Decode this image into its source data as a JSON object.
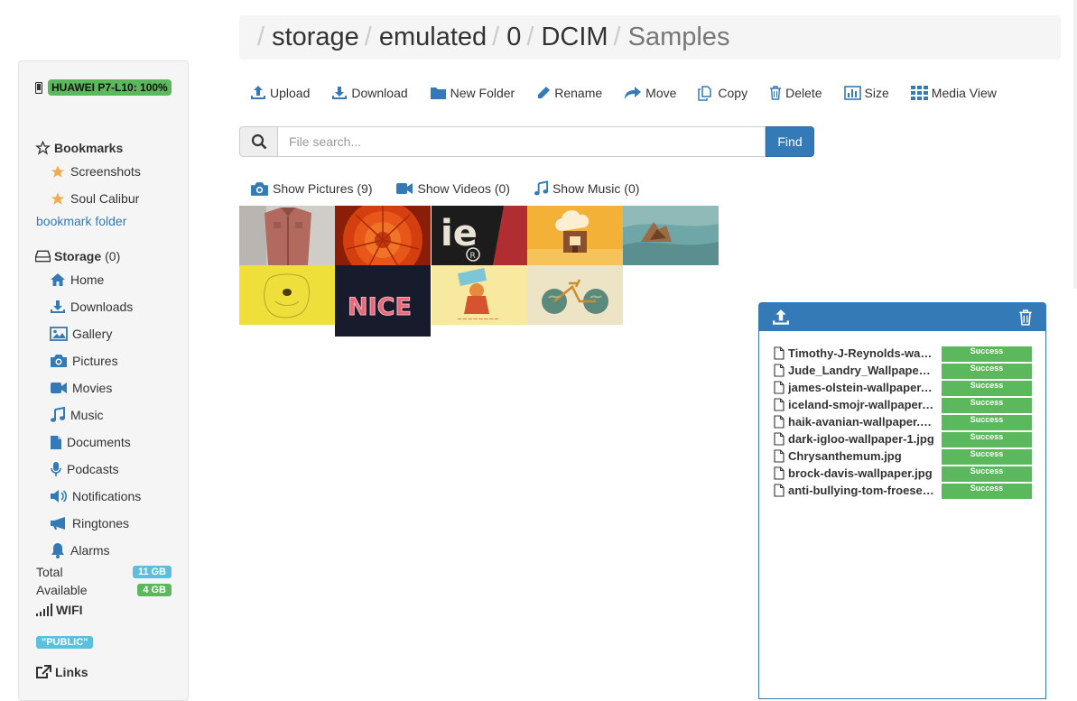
{
  "sidebar": {
    "device": {
      "name": "HUAWEI P7-L10",
      "battery": "100%"
    },
    "bookmarks_heading": "Bookmarks",
    "bookmarks": [
      {
        "label": "Screenshots"
      },
      {
        "label": "Soul Calibur"
      }
    ],
    "bookmark_folder": "bookmark folder",
    "storage_heading": "Storage",
    "storage_count": "(0)",
    "storage_items": [
      {
        "label": "Home",
        "icon": "home-icon"
      },
      {
        "label": "Downloads",
        "icon": "download-icon"
      },
      {
        "label": "Gallery",
        "icon": "image-icon"
      },
      {
        "label": "Pictures",
        "icon": "camera-icon"
      },
      {
        "label": "Movies",
        "icon": "video-icon"
      },
      {
        "label": "Music",
        "icon": "music-icon"
      },
      {
        "label": "Documents",
        "icon": "file-icon"
      },
      {
        "label": "Podcasts",
        "icon": "microphone-icon"
      },
      {
        "label": "Notifications",
        "icon": "volume-icon"
      },
      {
        "label": "Ringtones",
        "icon": "bullhorn-icon"
      },
      {
        "label": "Alarms",
        "icon": "bell-icon"
      }
    ],
    "total_label": "Total",
    "total_value": "11 GB",
    "available_label": "Available",
    "available_value": "4 GB",
    "network": "WIFI",
    "public_badge": "\"PUBLIC\"",
    "links_heading": "Links"
  },
  "breadcrumb": [
    "storage",
    "emulated",
    "0",
    "DCIM",
    "Samples"
  ],
  "toolbar": {
    "upload": "Upload",
    "download": "Download",
    "new_folder": "New Folder",
    "rename": "Rename",
    "move": "Move",
    "copy": "Copy",
    "delete": "Delete",
    "size": "Size",
    "media_view": "Media View"
  },
  "search": {
    "placeholder": "File search...",
    "button": "Find"
  },
  "media_tabs": {
    "pictures": "Show Pictures (9)",
    "videos": "Show Videos (0)",
    "music": "Show Music (0)"
  },
  "uploads": [
    {
      "name": "Timothy-J-Reynolds-wallpaper.jpg",
      "status": "Success"
    },
    {
      "name": "Jude_Landry_Wallpaper.jpg",
      "status": "Success"
    },
    {
      "name": "james-olstein-wallpaper.jpg",
      "status": "Success"
    },
    {
      "name": "iceland-smojr-wallpaper.jpg",
      "status": "Success"
    },
    {
      "name": "haik-avanian-wallpaper.jpg",
      "status": "Success"
    },
    {
      "name": "dark-igloo-wallpaper-1.jpg",
      "status": "Success"
    },
    {
      "name": "Chrysanthemum.jpg",
      "status": "Success"
    },
    {
      "name": "brock-davis-wallpaper.jpg",
      "status": "Success"
    },
    {
      "name": "anti-bullying-tom-froese.jpg",
      "status": "Success"
    }
  ],
  "colors": {
    "primary": "#337ab7",
    "success": "#5cb85c",
    "info": "#5bc0de"
  }
}
